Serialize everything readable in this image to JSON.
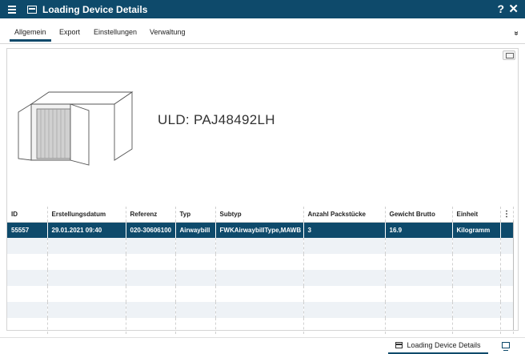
{
  "window": {
    "title": "Loading Device Details",
    "help_label": "?",
    "close_label": "✕"
  },
  "tabs": [
    {
      "label": "Allgemein",
      "active": true
    },
    {
      "label": "Export"
    },
    {
      "label": "Einstellungen"
    },
    {
      "label": "Verwaltung"
    }
  ],
  "more_tabs_label": "»",
  "uld": {
    "label": "ULD: PAJ48492LH"
  },
  "table": {
    "columns": [
      "ID",
      "Erstellungsdatum",
      "Referenz",
      "Typ",
      "Subtyp",
      "Anzahl Packstücke",
      "Gewicht Brutto",
      "Einheit"
    ],
    "column_menu_label": "⋮",
    "rows": [
      [
        "55557",
        "29.01.2021 09:40",
        "020-30606100",
        "Airwaybill",
        "FWKAirwaybillType,MAWB",
        "3",
        "16.9",
        "Kilogramm"
      ]
    ]
  },
  "status_bar": {
    "active_tab": "Loading Device Details"
  },
  "colors": {
    "brand": "#0e4a6b"
  }
}
